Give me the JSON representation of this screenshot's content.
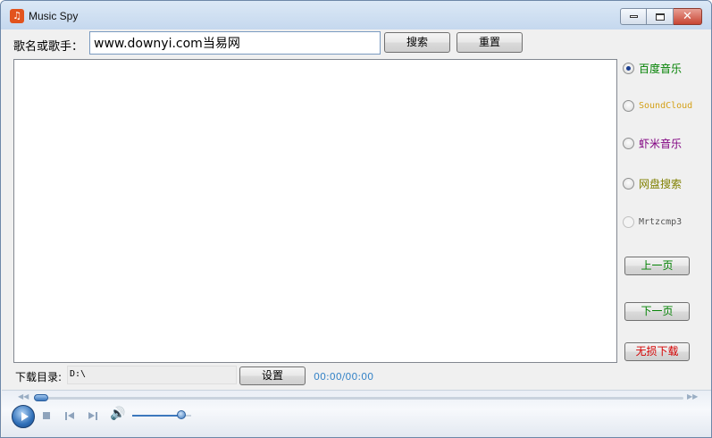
{
  "window": {
    "title": "Music  Spy",
    "icon": "music-note-icon"
  },
  "search": {
    "label": "歌名或歌手：",
    "value": "www.downyi.com当易网",
    "search_button": "搜索",
    "reset_button": "重置"
  },
  "sources": [
    {
      "label": "百度音乐",
      "color": "#008000",
      "checked": true,
      "enabled": true
    },
    {
      "label": "SoundCloud",
      "color": "#d4a017",
      "checked": false,
      "enabled": true
    },
    {
      "label": "虾米音乐",
      "color": "#800080",
      "checked": false,
      "enabled": true
    },
    {
      "label": "网盘搜索",
      "color": "#808000",
      "checked": false,
      "enabled": true
    },
    {
      "label": "Mrtzcmp3",
      "color": "#555555",
      "checked": false,
      "enabled": false
    }
  ],
  "side_buttons": {
    "prev_page": {
      "label": "上一页",
      "color": "#008000"
    },
    "next_page": {
      "label": "下一页",
      "color": "#008000"
    },
    "lossless": {
      "label": "无损下载",
      "color": "#d40000"
    }
  },
  "download": {
    "label": "下载目录:",
    "path": "D:\\",
    "settings_button": "设置"
  },
  "player": {
    "time": "00:00/00:00",
    "progress": 0,
    "volume": 0.85
  }
}
